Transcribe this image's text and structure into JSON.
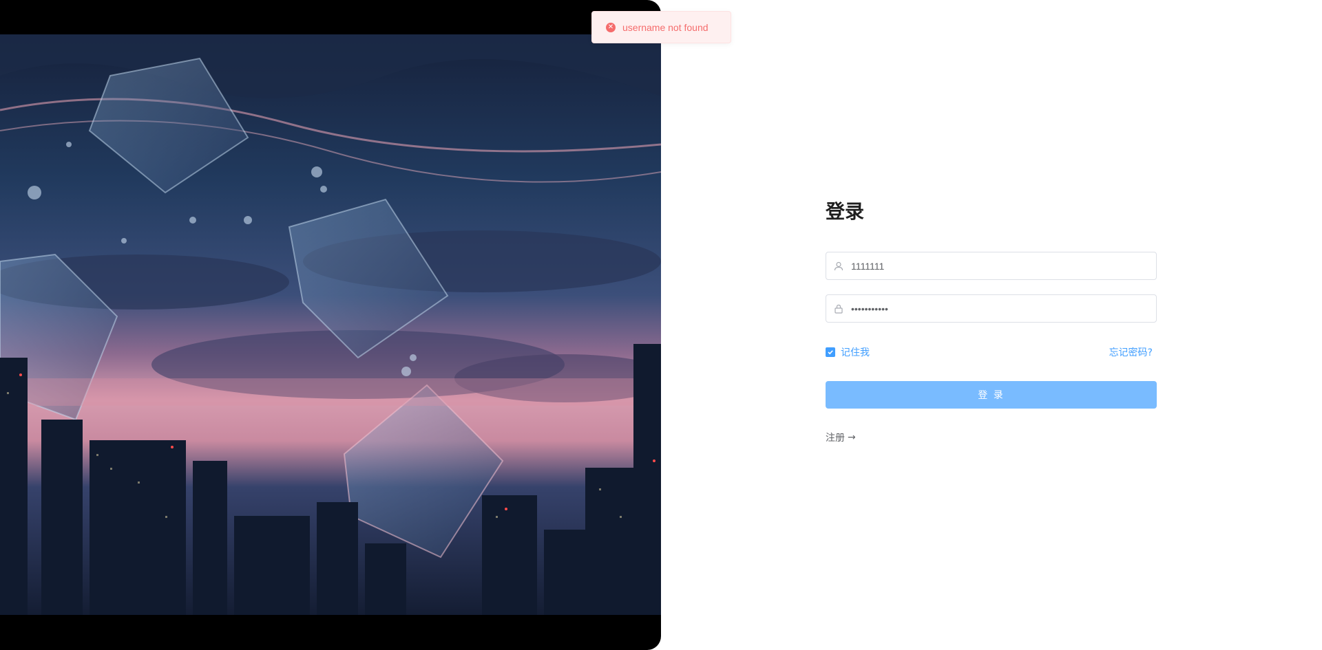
{
  "toast": {
    "icon": "error-circle-icon",
    "message": "username not found",
    "color": "#f56c6c"
  },
  "login": {
    "title": "登录",
    "username_value": "1111111",
    "password_mask": "•••••••••••",
    "remember_label": "记住我",
    "remember_checked": true,
    "forgot_label": "忘记密码?",
    "submit_label": "登 录",
    "register_label": "注册",
    "register_arrow": "→"
  },
  "colors": {
    "primary": "#409eff",
    "button_disabled": "#79bbff",
    "error": "#f56c6c"
  }
}
